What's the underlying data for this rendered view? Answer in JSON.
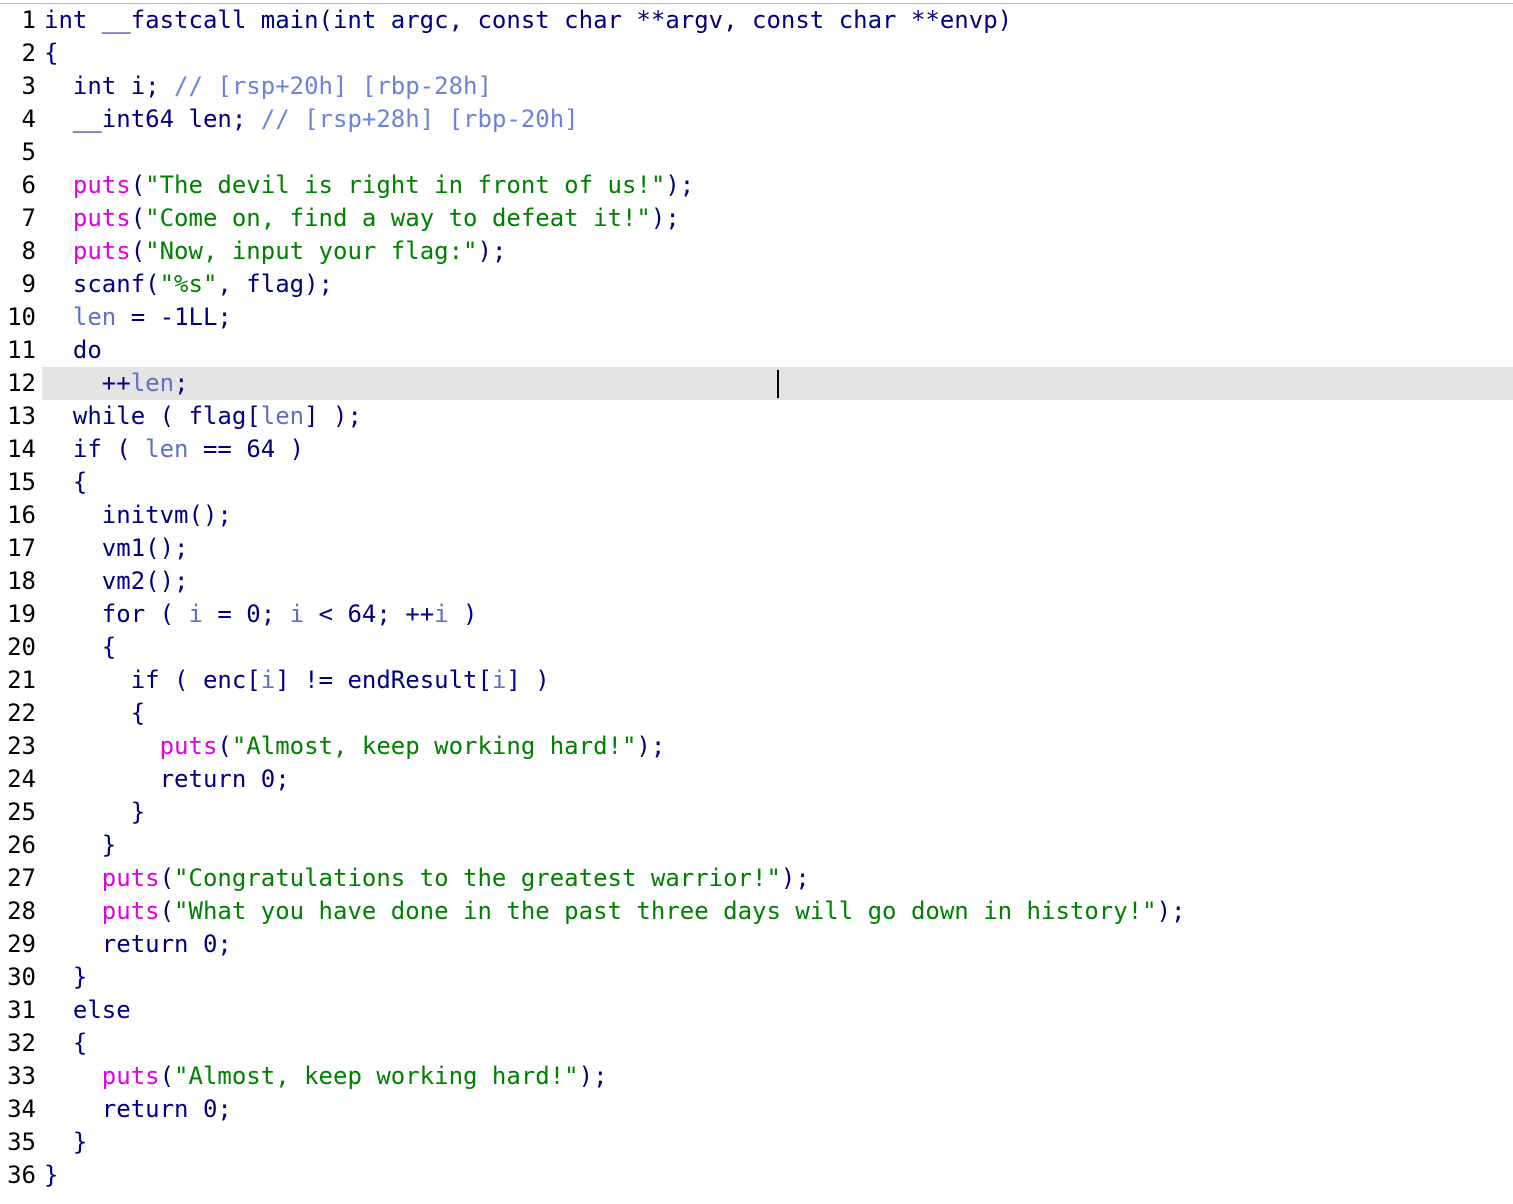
{
  "editor": {
    "cursor_line": 12,
    "lines": [
      {
        "n": "1",
        "tokens": [
          [
            "kw",
            "int "
          ],
          [
            "tx",
            "__fastcall main(int argc, const char **argv, const char **envp)"
          ]
        ]
      },
      {
        "n": "2",
        "tokens": [
          [
            "tx",
            "{"
          ]
        ]
      },
      {
        "n": "3",
        "tokens": [
          [
            "tx",
            "  int i; "
          ],
          [
            "cmt",
            "// [rsp+20h] [rbp-28h]"
          ]
        ]
      },
      {
        "n": "4",
        "tokens": [
          [
            "tx",
            "  __int64 len; "
          ],
          [
            "cmt",
            "// [rsp+28h] [rbp-20h]"
          ]
        ]
      },
      {
        "n": "5",
        "tokens": []
      },
      {
        "n": "6",
        "tokens": [
          [
            "tx",
            "  "
          ],
          [
            "fn-lib",
            "puts"
          ],
          [
            "tx",
            "("
          ],
          [
            "str",
            "\"The devil is right in front of us!\""
          ],
          [
            "tx",
            ");"
          ]
        ]
      },
      {
        "n": "7",
        "tokens": [
          [
            "tx",
            "  "
          ],
          [
            "fn-lib",
            "puts"
          ],
          [
            "tx",
            "("
          ],
          [
            "str",
            "\"Come on, find a way to defeat it!\""
          ],
          [
            "tx",
            ");"
          ]
        ]
      },
      {
        "n": "8",
        "tokens": [
          [
            "tx",
            "  "
          ],
          [
            "fn-lib",
            "puts"
          ],
          [
            "tx",
            "("
          ],
          [
            "str",
            "\"Now, input your flag:\""
          ],
          [
            "tx",
            ");"
          ]
        ]
      },
      {
        "n": "9",
        "tokens": [
          [
            "tx",
            "  scanf("
          ],
          [
            "str",
            "\"%s\""
          ],
          [
            "tx",
            ", flag);"
          ]
        ]
      },
      {
        "n": "10",
        "tokens": [
          [
            "tx",
            "  "
          ],
          [
            "var",
            "len"
          ],
          [
            "tx",
            " = -1LL;"
          ]
        ]
      },
      {
        "n": "11",
        "tokens": [
          [
            "tx",
            "  do"
          ]
        ]
      },
      {
        "n": "12",
        "tokens": [
          [
            "tx",
            "    ++"
          ],
          [
            "var",
            "len"
          ],
          [
            "tx",
            ";"
          ]
        ]
      },
      {
        "n": "13",
        "tokens": [
          [
            "tx",
            "  while ( flag["
          ],
          [
            "var",
            "len"
          ],
          [
            "tx",
            "] );"
          ]
        ]
      },
      {
        "n": "14",
        "tokens": [
          [
            "tx",
            "  if ( "
          ],
          [
            "var",
            "len"
          ],
          [
            "tx",
            " == 64 )"
          ]
        ]
      },
      {
        "n": "15",
        "tokens": [
          [
            "tx",
            "  {"
          ]
        ]
      },
      {
        "n": "16",
        "tokens": [
          [
            "tx",
            "    initvm();"
          ]
        ]
      },
      {
        "n": "17",
        "tokens": [
          [
            "tx",
            "    vm1();"
          ]
        ]
      },
      {
        "n": "18",
        "tokens": [
          [
            "tx",
            "    vm2();"
          ]
        ]
      },
      {
        "n": "19",
        "tokens": [
          [
            "tx",
            "    for ( "
          ],
          [
            "var",
            "i"
          ],
          [
            "tx",
            " = 0; "
          ],
          [
            "var",
            "i"
          ],
          [
            "tx",
            " < 64; ++"
          ],
          [
            "var",
            "i"
          ],
          [
            "tx",
            " )"
          ]
        ]
      },
      {
        "n": "20",
        "tokens": [
          [
            "tx",
            "    {"
          ]
        ]
      },
      {
        "n": "21",
        "tokens": [
          [
            "tx",
            "      if ( enc["
          ],
          [
            "var",
            "i"
          ],
          [
            "tx",
            "] != endResult["
          ],
          [
            "var",
            "i"
          ],
          [
            "tx",
            "] )"
          ]
        ]
      },
      {
        "n": "22",
        "tokens": [
          [
            "tx",
            "      {"
          ]
        ]
      },
      {
        "n": "23",
        "tokens": [
          [
            "tx",
            "        "
          ],
          [
            "fn-lib",
            "puts"
          ],
          [
            "tx",
            "("
          ],
          [
            "str",
            "\"Almost, keep working hard!\""
          ],
          [
            "tx",
            ");"
          ]
        ]
      },
      {
        "n": "24",
        "tokens": [
          [
            "tx",
            "        return 0;"
          ]
        ]
      },
      {
        "n": "25",
        "tokens": [
          [
            "tx",
            "      }"
          ]
        ]
      },
      {
        "n": "26",
        "tokens": [
          [
            "tx",
            "    }"
          ]
        ]
      },
      {
        "n": "27",
        "tokens": [
          [
            "tx",
            "    "
          ],
          [
            "fn-lib",
            "puts"
          ],
          [
            "tx",
            "("
          ],
          [
            "str",
            "\"Congratulations to the greatest warrior!\""
          ],
          [
            "tx",
            ");"
          ]
        ]
      },
      {
        "n": "28",
        "tokens": [
          [
            "tx",
            "    "
          ],
          [
            "fn-lib",
            "puts"
          ],
          [
            "tx",
            "("
          ],
          [
            "str",
            "\"What you have done in the past three days will go down in history!\""
          ],
          [
            "tx",
            ");"
          ]
        ]
      },
      {
        "n": "29",
        "tokens": [
          [
            "tx",
            "    return 0;"
          ]
        ]
      },
      {
        "n": "30",
        "tokens": [
          [
            "tx",
            "  }"
          ]
        ]
      },
      {
        "n": "31",
        "tokens": [
          [
            "tx",
            "  else"
          ]
        ]
      },
      {
        "n": "32",
        "tokens": [
          [
            "tx",
            "  {"
          ]
        ]
      },
      {
        "n": "33",
        "tokens": [
          [
            "tx",
            "    "
          ],
          [
            "fn-lib",
            "puts"
          ],
          [
            "tx",
            "("
          ],
          [
            "str",
            "\"Almost, keep working hard!\""
          ],
          [
            "tx",
            ");"
          ]
        ]
      },
      {
        "n": "34",
        "tokens": [
          [
            "tx",
            "    return 0;"
          ]
        ]
      },
      {
        "n": "35",
        "tokens": [
          [
            "tx",
            "  }"
          ]
        ]
      },
      {
        "n": "36",
        "tokens": [
          [
            "tx",
            "}"
          ]
        ]
      }
    ]
  },
  "colors": {
    "text": "#000080",
    "library_function": "#e000e0",
    "string": "#008000",
    "variable": "#6070c8",
    "comment": "#6e82d8",
    "current_line_bg": "#e4e4e4"
  }
}
